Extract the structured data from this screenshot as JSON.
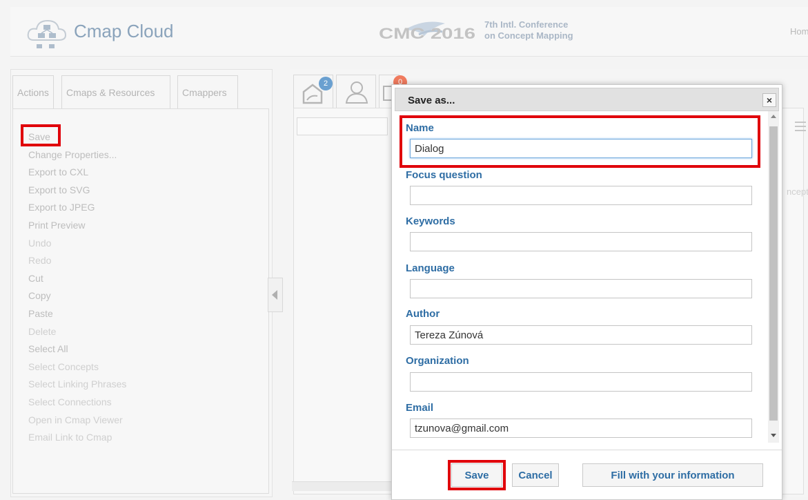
{
  "header": {
    "app_title": "Cmap Cloud",
    "cmc_logo_text": "CMC 2016",
    "conference_line1": "7th Intl. Conference",
    "conference_line2": "on Concept Mapping",
    "home_link": "Home"
  },
  "left_panel": {
    "tabs": [
      {
        "label": "Actions"
      },
      {
        "label": "Cmaps & Resources"
      },
      {
        "label": "Cmappers"
      }
    ],
    "menu": [
      {
        "label": "Save",
        "enabled": true
      },
      {
        "label": "Change Properties...",
        "enabled": true
      },
      {
        "label": "Export to CXL",
        "enabled": true
      },
      {
        "label": "Export to SVG",
        "enabled": true
      },
      {
        "label": "Export to JPEG",
        "enabled": true
      },
      {
        "label": "Print Preview",
        "enabled": true
      },
      {
        "label": "Undo",
        "enabled": false
      },
      {
        "label": "Redo",
        "enabled": false
      },
      {
        "label": "Cut",
        "enabled": true
      },
      {
        "label": "Copy",
        "enabled": true
      },
      {
        "label": "Paste",
        "enabled": true
      },
      {
        "label": "Delete",
        "enabled": false
      },
      {
        "label": "Select All",
        "enabled": true
      },
      {
        "label": "Select Concepts",
        "enabled": false
      },
      {
        "label": "Select Linking Phrases",
        "enabled": false
      },
      {
        "label": "Select Connections",
        "enabled": false
      },
      {
        "label": "Open in Cmap Viewer",
        "enabled": false
      },
      {
        "label": "Email Link to Cmap",
        "enabled": false
      }
    ]
  },
  "center": {
    "badges": {
      "notifications": "2",
      "messages": "0"
    },
    "partial_text": "ncept"
  },
  "dialog": {
    "title": "Save as...",
    "close_icon": "×",
    "fields": {
      "name": {
        "label": "Name",
        "value": "Dialog"
      },
      "focus_question": {
        "label": "Focus question",
        "value": ""
      },
      "keywords": {
        "label": "Keywords",
        "value": ""
      },
      "language": {
        "label": "Language",
        "value": ""
      },
      "author": {
        "label": "Author",
        "value": "Tereza Zúnová"
      },
      "organization": {
        "label": "Organization",
        "value": ""
      },
      "email": {
        "label": "Email",
        "value": "tzunova@gmail.com"
      }
    },
    "buttons": {
      "save": "Save",
      "cancel": "Cancel",
      "fill": "Fill with your information"
    }
  },
  "colors": {
    "highlight": "#e0000a",
    "label_blue": "#2e6da4",
    "badge_blue": "#6aa0d0",
    "badge_red": "#f07b5e"
  }
}
